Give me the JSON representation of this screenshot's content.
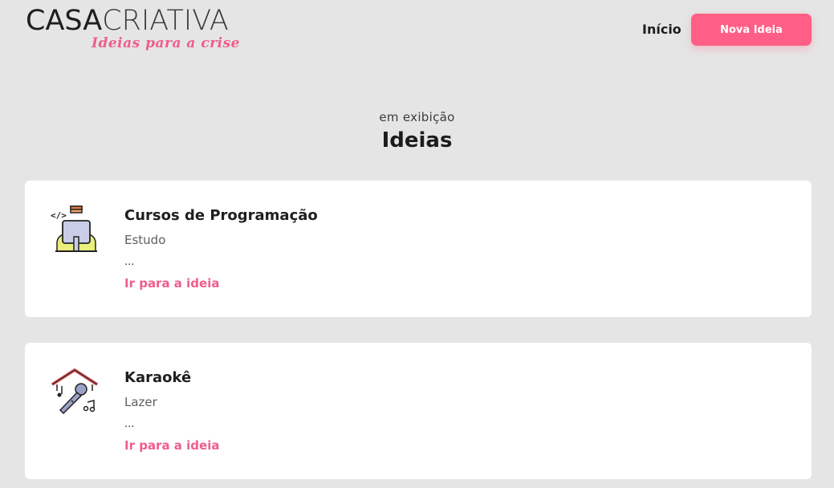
{
  "header": {
    "logo": {
      "part1": "CASA",
      "part2": "CRIATIVA",
      "tagline": "Ideias para a crise"
    },
    "nav_home": "Início",
    "new_idea_button": "Nova Ideia"
  },
  "section": {
    "subtitle": "em exibição",
    "title": "Ideias"
  },
  "ideas": [
    {
      "icon": "programmer-laptop-icon",
      "title": "Cursos de Programação",
      "category": "Estudo",
      "description": "...",
      "link": "Ir para a ideia"
    },
    {
      "icon": "karaoke-microphone-icon",
      "title": "Karaokê",
      "category": "Lazer",
      "description": "...",
      "link": "Ir para a ideia"
    }
  ],
  "colors": {
    "background": "#e5e5e5",
    "accent": "#ff5f86",
    "link": "#ef5d8b",
    "card": "#ffffff"
  }
}
